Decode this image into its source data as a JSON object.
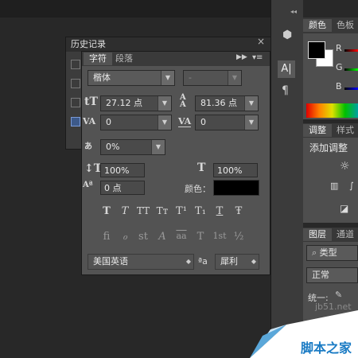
{
  "history_panel": {
    "title": "历史记录"
  },
  "char_panel": {
    "tabs": [
      "字符",
      "段落"
    ],
    "font_family": "楷体",
    "font_style": "-",
    "font_size": "27.12 点",
    "leading": "81.36 点",
    "kerning": "0",
    "tracking": "0",
    "scale_percent": "0%",
    "vertical_scale": "100%",
    "horizontal_scale": "100%",
    "baseline_shift": "0 点",
    "color_label": "颜色：",
    "color_swatch": "#000000",
    "style_buttons": [
      "T",
      "T",
      "TT",
      "Tт",
      "T¹",
      "T₁",
      "T",
      "Ŧ"
    ],
    "opentype_buttons": [
      "fi",
      "ℴ",
      "st",
      "A",
      "aa",
      "T",
      "1st",
      "½"
    ],
    "language": "美国英语",
    "aa_label": "ªa",
    "aa_method": "犀利"
  },
  "right_panels": {
    "color_tabs": [
      "颜色",
      "色板"
    ],
    "channels": [
      "R",
      "G",
      "B"
    ],
    "adjust_tabs": [
      "调整",
      "样式"
    ],
    "adjust_title": "添加调整",
    "layers_tabs": [
      "图层",
      "通道"
    ],
    "kind_label": "类型",
    "blend_mode": "正常",
    "unify_label": "统一:"
  },
  "watermark": {
    "site": "jb51.net",
    "brand": "脚本之家"
  }
}
